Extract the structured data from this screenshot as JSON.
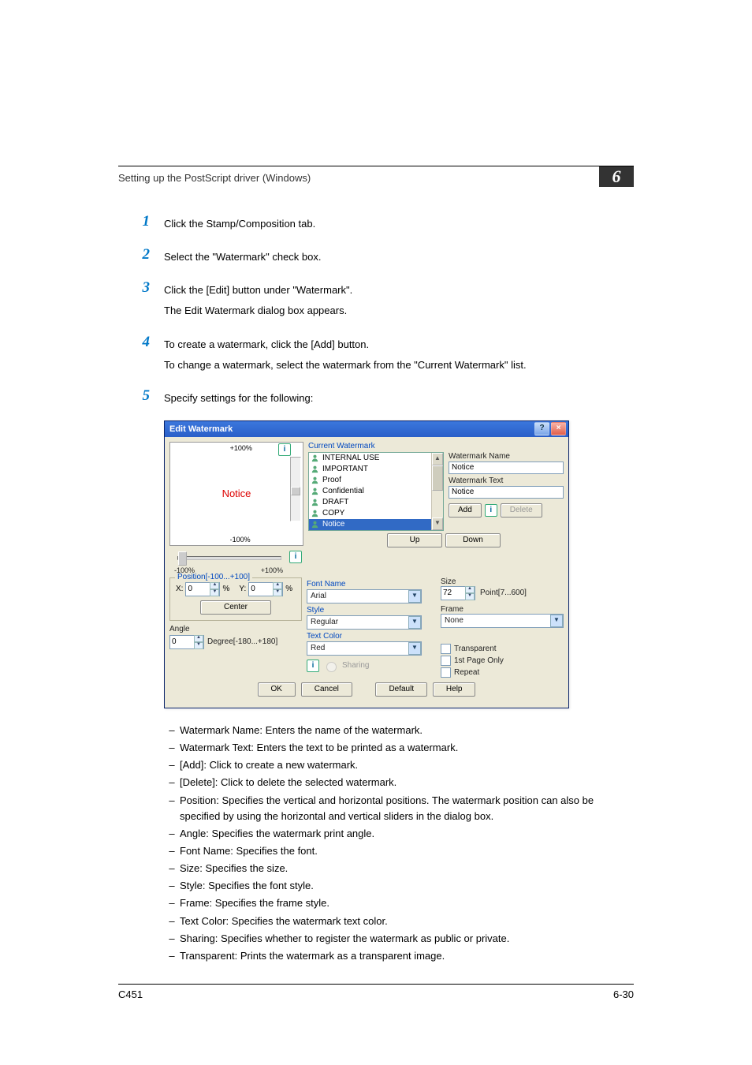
{
  "header": {
    "title": "Setting up the PostScript driver (Windows)",
    "chapter": "6"
  },
  "steps": [
    {
      "num": "1",
      "lines": [
        "Click the Stamp/Composition tab."
      ]
    },
    {
      "num": "2",
      "lines": [
        "Select the \"Watermark\" check box."
      ]
    },
    {
      "num": "3",
      "lines": [
        "Click the [Edit] button under \"Watermark\".",
        "The Edit Watermark dialog box appears."
      ]
    },
    {
      "num": "4",
      "lines": [
        "To create a watermark, click the [Add] button.",
        "To change a watermark, select the watermark from the \"Current Watermark\" list."
      ]
    },
    {
      "num": "5",
      "lines": [
        "Specify settings for the following:"
      ]
    }
  ],
  "dialog": {
    "title": "Edit Watermark",
    "preview_text": "Notice",
    "top_plus": "+100%",
    "top_minus": "-100%",
    "slider_left": "-100%",
    "slider_right": "+100%",
    "current_label": "Current Watermark",
    "list_items": [
      "INTERNAL USE",
      "IMPORTANT",
      "Proof",
      "Confidential",
      "DRAFT",
      "COPY",
      "Notice"
    ],
    "up_btn": "Up",
    "down_btn": "Down",
    "wm_name_label": "Watermark Name",
    "wm_name_value": "Notice",
    "wm_text_label": "Watermark Text",
    "wm_text_value": "Notice",
    "add_btn": "Add",
    "delete_btn": "Delete",
    "position_legend": "Position[-100...+100]",
    "x_label": "X:",
    "y_label": "Y:",
    "x_val": "0",
    "y_val": "0",
    "pct": "%",
    "center_btn": "Center",
    "angle_label": "Angle",
    "angle_val": "0",
    "angle_range": "Degree[-180...+180]",
    "font_label": "Font Name",
    "font_value": "Arial",
    "style_label": "Style",
    "style_value": "Regular",
    "color_label": "Text Color",
    "color_value": "Red",
    "sharing_label": "Sharing",
    "size_label": "Size",
    "size_value": "72",
    "size_range": "Point[7...600]",
    "frame_label": "Frame",
    "frame_value": "None",
    "transparent": "Transparent",
    "firstpage": "1st Page Only",
    "repeat": "Repeat",
    "ok": "OK",
    "cancel": "Cancel",
    "default": "Default",
    "help": "Help"
  },
  "descriptions": [
    "Watermark Name: Enters the name of the watermark.",
    "Watermark Text: Enters the text to be printed as a watermark.",
    "[Add]: Click to create a new watermark.",
    "[Delete]: Click to delete the selected watermark.",
    "Position: Specifies the vertical and horizontal positions. The watermark position can also be specified by using the horizontal and vertical sliders in the dialog box.",
    "Angle: Specifies the watermark print angle.",
    "Font Name: Specifies the font.",
    "Size: Specifies the size.",
    "Style: Specifies the font style.",
    "Frame: Specifies the frame style.",
    "Text Color: Specifies the watermark text color.",
    "Sharing: Specifies whether to register the watermark as public or private.",
    "Transparent: Prints the watermark as a transparent image."
  ],
  "footer": {
    "left": "C451",
    "right": "6-30"
  }
}
